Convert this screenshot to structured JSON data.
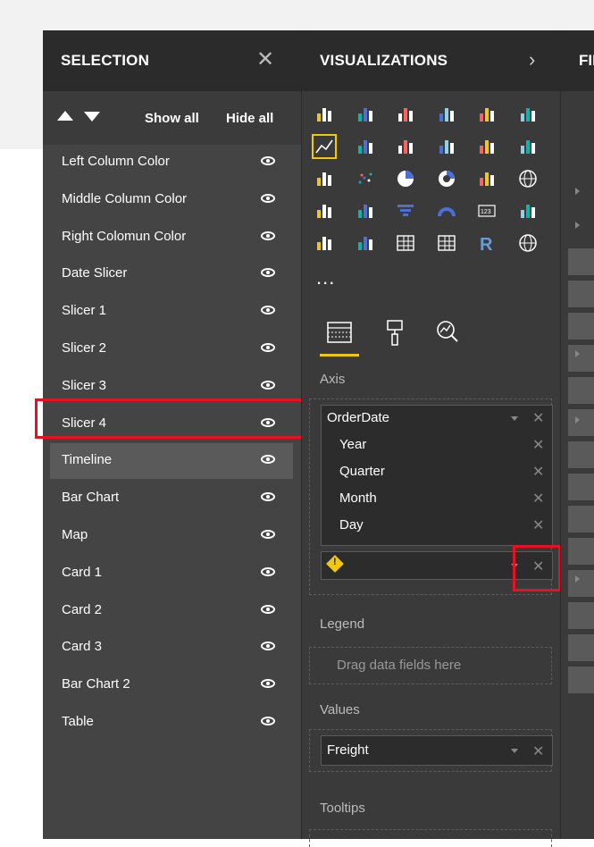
{
  "selection_pane": {
    "title": "SELECTION",
    "close_glyph": "✕",
    "show_all": "Show all",
    "hide_all": "Hide all",
    "items": [
      {
        "label": "Left Column Color",
        "selected": false
      },
      {
        "label": "Middle Column Color",
        "selected": false
      },
      {
        "label": "Right Colomun Color",
        "selected": false
      },
      {
        "label": "Date Slicer",
        "selected": false
      },
      {
        "label": "Slicer 1",
        "selected": false
      },
      {
        "label": "Slicer 2",
        "selected": false
      },
      {
        "label": "Slicer 3",
        "selected": false
      },
      {
        "label": "Slicer 4",
        "selected": false
      },
      {
        "label": "Timeline",
        "selected": true
      },
      {
        "label": "Bar Chart",
        "selected": false
      },
      {
        "label": "Map",
        "selected": false
      },
      {
        "label": "Card 1",
        "selected": false
      },
      {
        "label": "Card 2",
        "selected": false
      },
      {
        "label": "Card 3",
        "selected": false
      },
      {
        "label": "Bar Chart 2",
        "selected": false
      },
      {
        "label": "Table",
        "selected": false
      }
    ]
  },
  "visualizations_pane": {
    "title": "VISUALIZATIONS",
    "expand_glyph": "›",
    "more_glyph": "...",
    "icons": [
      "stacked-bar-icon",
      "stacked-column-icon",
      "clustered-bar-icon",
      "clustered-column-icon",
      "percent-bar-icon",
      "percent-column-icon",
      "line-chart-icon",
      "area-chart-icon",
      "stacked-area-icon",
      "line-column-icon",
      "line-clustered-column-icon",
      "ribbon-chart-icon",
      "waterfall-icon",
      "scatter-icon",
      "pie-chart-icon",
      "donut-chart-icon",
      "treemap-icon",
      "map-icon",
      "filled-map-icon",
      "shape-map-icon",
      "funnel-icon",
      "gauge-icon",
      "card-icon",
      "multirow-card-icon",
      "kpi-icon",
      "slicer-icon",
      "table-icon",
      "matrix-icon",
      "r-visual-icon",
      "globe-icon"
    ],
    "selected_icon_index": 6,
    "tabs": [
      "fields-tab-icon",
      "format-tab-icon",
      "analytics-tab-icon"
    ],
    "wells": {
      "axis": {
        "label": "Axis",
        "field": "OrderDate",
        "sub_fields": [
          "Year",
          "Quarter",
          "Month",
          "Day"
        ],
        "warning_field_glyph": "!"
      },
      "legend": {
        "label": "Legend",
        "placeholder": "Drag data fields here"
      },
      "values": {
        "label": "Values",
        "field": "Freight"
      },
      "tooltips": {
        "label": "Tooltips"
      }
    },
    "remove_glyph": "✕"
  },
  "fields_pane": {
    "title": "FIELDS"
  },
  "colors": {
    "highlight_box": "#e81123",
    "accent_yellow": "#f2c80f",
    "pane_bg": "#444444",
    "header_bg": "#2b2b2b"
  }
}
